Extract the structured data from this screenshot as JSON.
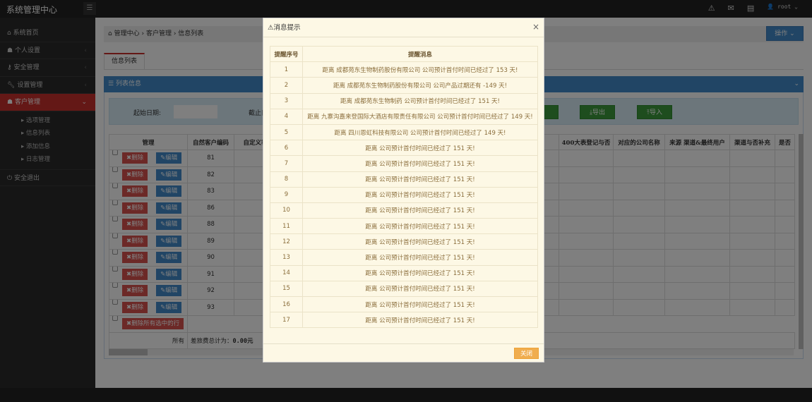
{
  "app": {
    "title": "系统管理中心",
    "user": "root",
    "icons": [
      "warning-icon",
      "envelope-icon",
      "tasks-icon",
      "user-icon"
    ]
  },
  "sidebar": {
    "items": [
      {
        "label": "系统首页",
        "icon": "home-icon"
      },
      {
        "label": "个人设置",
        "icon": "user-icon"
      },
      {
        "label": "安全管理",
        "icon": "key-icon"
      },
      {
        "label": "设置管理",
        "icon": "wrench-icon"
      },
      {
        "label": "客户管理",
        "icon": "user-icon",
        "active": true
      }
    ],
    "subitems": [
      "选项管理",
      "信息列表",
      "添加信息",
      "日志管理"
    ],
    "logout": "安全退出"
  },
  "breadcrumb": [
    "管理中心",
    "客户管理",
    "信息列表"
  ],
  "operation_button": "操作",
  "tab": "信息列表",
  "panel_title": "列表信息",
  "search": {
    "start_label": "起始日期:",
    "end_label": "截止日",
    "export": "导出",
    "import": "导入"
  },
  "table": {
    "headers": [
      "管理",
      "自然客户编码",
      "自定义客",
      "400大表登记与否",
      "对应的公司名称",
      "来源 渠道&最终用户",
      "渠道与否补充",
      "是否"
    ],
    "delete_label": "删除",
    "edit_label": "编辑",
    "codes": [
      "81",
      "82",
      "83",
      "86",
      "88",
      "89",
      "90",
      "91",
      "92",
      "93"
    ],
    "delete_selected": "删除所有选中的行",
    "sum_label": "所有",
    "sum_text": "差旅费总计为：",
    "sum_value": "0.00元"
  },
  "modal": {
    "title": "消息提示",
    "headers": [
      "提醒序号",
      "提醒消息"
    ],
    "rows": [
      [
        "1",
        "距离 成都苑东生物制药股份有限公司 公司预计首付时间已经过了 153 天!"
      ],
      [
        "2",
        "距离 成都苑东生物制药股份有限公司 公司产品过期还有 -149 天!"
      ],
      [
        "3",
        "距离 成都苑东生物制药 公司预计首付时间已经过了 151 天!"
      ],
      [
        "4",
        "距离 九寨沟嘉来登国际大酒店有限责任有限公司 公司预计首付时间已经过了 149 天!"
      ],
      [
        "5",
        "距离 四川恩虹科技有限公司 公司预计首付时间已经过了 149 天!"
      ],
      [
        "6",
        "距离 公司预计首付时间已经过了 151 天!"
      ],
      [
        "7",
        "距离 公司预计首付时间已经过了 151 天!"
      ],
      [
        "8",
        "距离 公司预计首付时间已经过了 151 天!"
      ],
      [
        "9",
        "距离 公司预计首付时间已经过了 151 天!"
      ],
      [
        "10",
        "距离 公司预计首付时间已经过了 151 天!"
      ],
      [
        "11",
        "距离 公司预计首付时间已经过了 151 天!"
      ],
      [
        "12",
        "距离 公司预计首付时间已经过了 151 天!"
      ],
      [
        "13",
        "距离 公司预计首付时间已经过了 151 天!"
      ],
      [
        "14",
        "距离 公司预计首付时间已经过了 151 天!"
      ],
      [
        "15",
        "距离 公司预计首付时间已经过了 151 天!"
      ],
      [
        "16",
        "距离 公司预计首付时间已经过了 151 天!"
      ],
      [
        "17",
        "距离 公司预计首付时间已经过了 151 天!"
      ]
    ],
    "close_button": "关闭"
  }
}
